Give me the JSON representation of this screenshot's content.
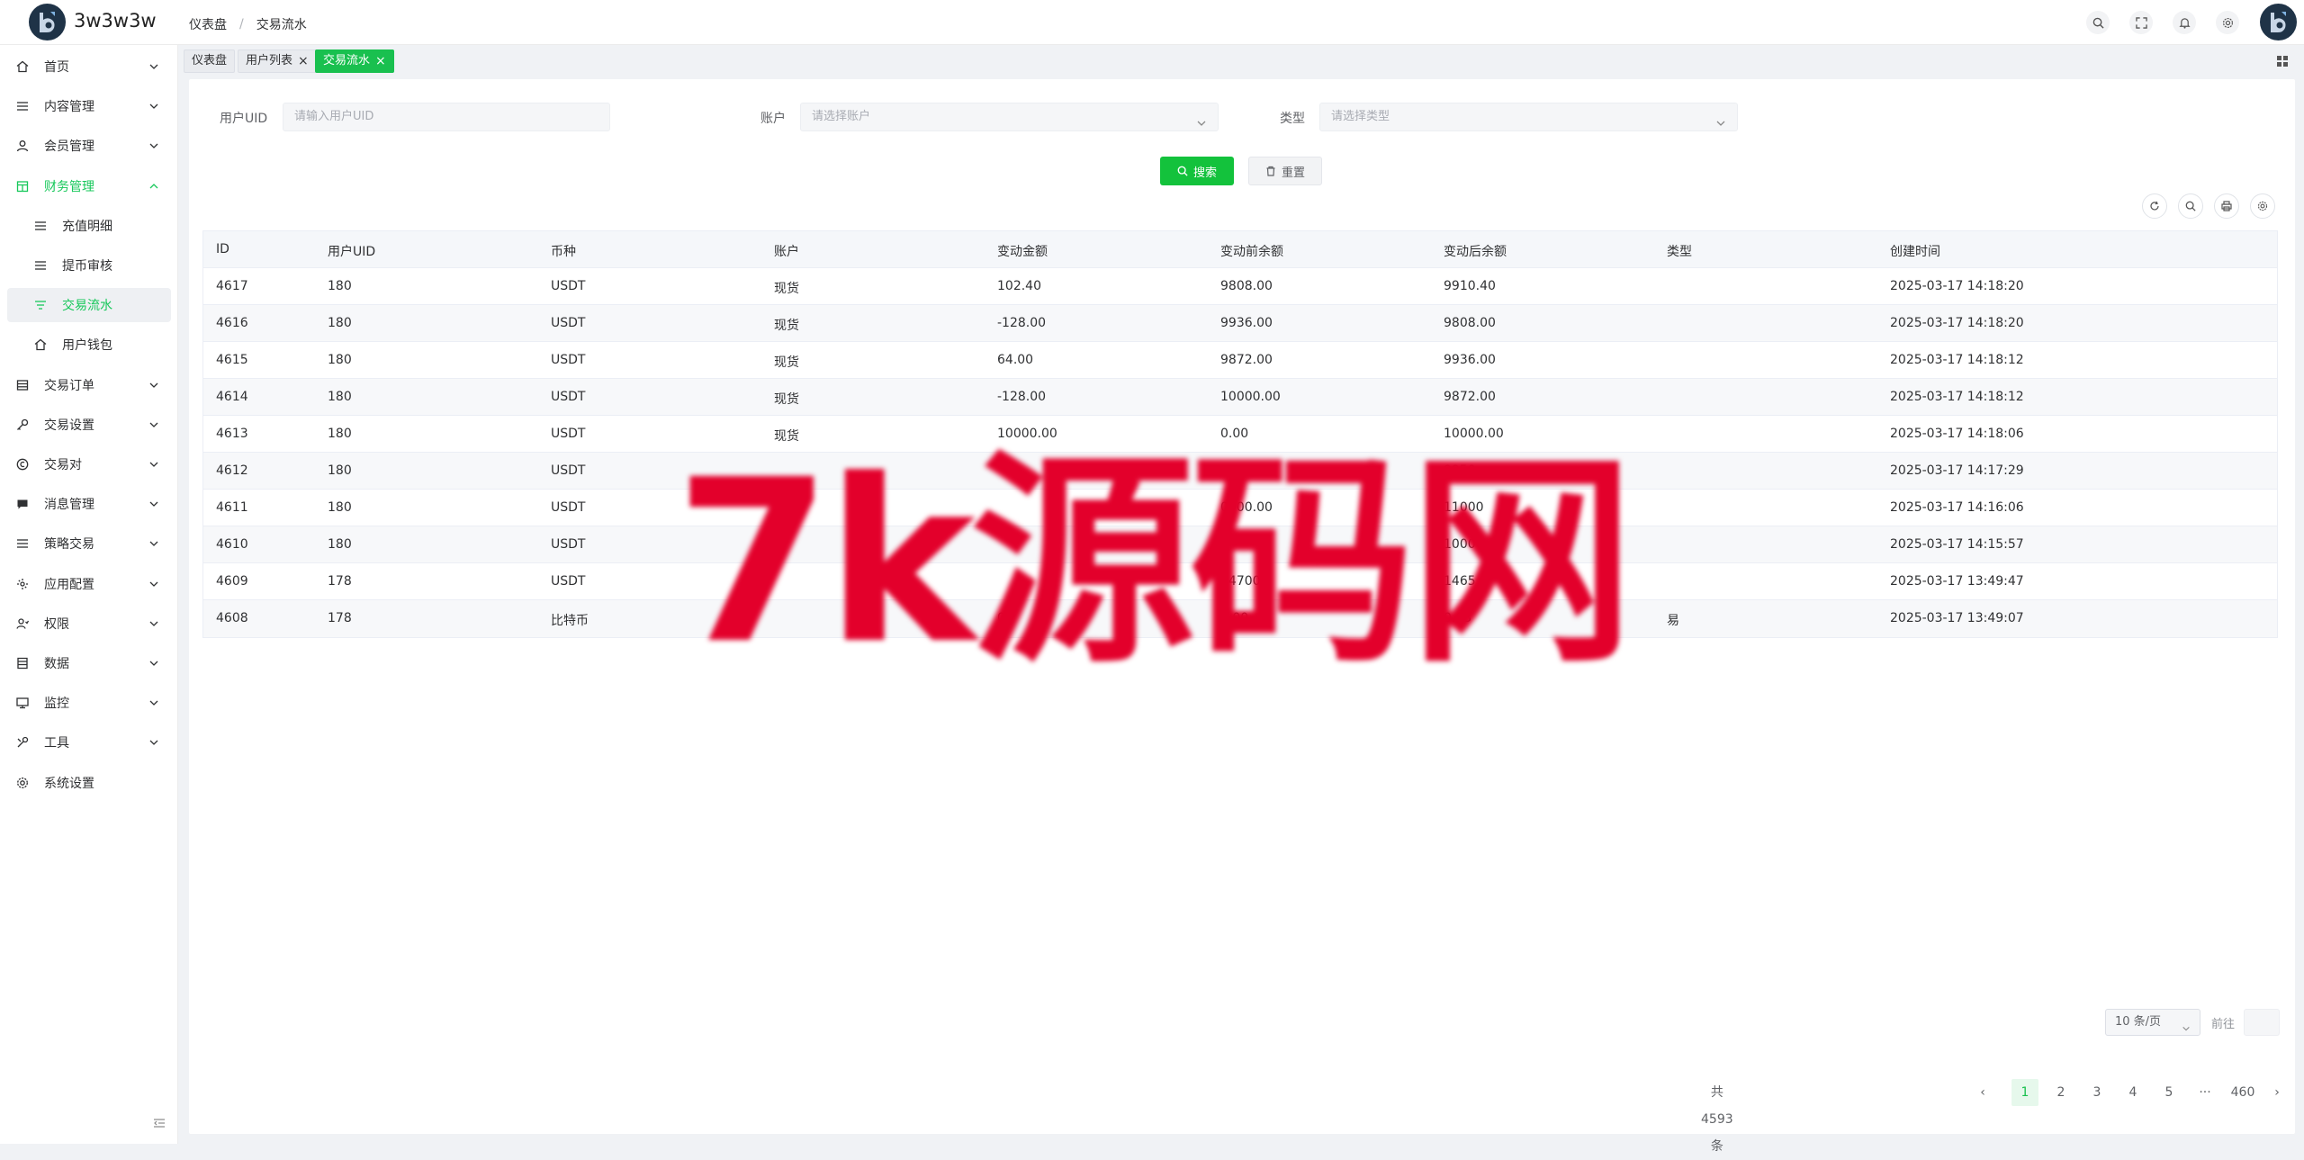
{
  "app": {
    "title": "3w3w3w"
  },
  "header": {
    "breadcrumb": [
      "仪表盘",
      "/",
      "交易流水"
    ],
    "icons": [
      "search-icon",
      "fullscreen-icon",
      "bell-icon",
      "gear-icon"
    ]
  },
  "sidebar": {
    "items": [
      {
        "label": "首页",
        "icon": "home-icon",
        "expandable": true
      },
      {
        "label": "内容管理",
        "icon": "list-icon",
        "expandable": true
      },
      {
        "label": "会员管理",
        "icon": "user-icon",
        "expandable": true
      },
      {
        "label": "财务管理",
        "icon": "finance-icon",
        "expandable": true,
        "open": true
      },
      {
        "label": "充值明细",
        "icon": "list-icon",
        "sub": true
      },
      {
        "label": "提币审核",
        "icon": "list-icon",
        "sub": true
      },
      {
        "label": "交易流水",
        "icon": "filter-icon",
        "sub": true,
        "active": true
      },
      {
        "label": "用户钱包",
        "icon": "home-icon",
        "sub": true
      },
      {
        "label": "交易订单",
        "icon": "table-icon",
        "expandable": true
      },
      {
        "label": "交易设置",
        "icon": "key-icon",
        "expandable": true
      },
      {
        "label": "交易对",
        "icon": "copyright-icon",
        "expandable": true
      },
      {
        "label": "消息管理",
        "icon": "message-icon",
        "expandable": true
      },
      {
        "label": "策略交易",
        "icon": "list-icon",
        "expandable": true
      },
      {
        "label": "应用配置",
        "icon": "config-icon",
        "expandable": true
      },
      {
        "label": "权限",
        "icon": "permission-icon",
        "expandable": true
      },
      {
        "label": "数据",
        "icon": "data-icon",
        "expandable": true
      },
      {
        "label": "监控",
        "icon": "monitor-icon",
        "expandable": true
      },
      {
        "label": "工具",
        "icon": "tool-icon",
        "expandable": true
      },
      {
        "label": "系统设置",
        "icon": "gear-icon",
        "expandable": false
      }
    ]
  },
  "tags": [
    {
      "label": "仪表盘",
      "closable": false,
      "active": false
    },
    {
      "label": "用户列表",
      "closable": true,
      "active": false
    },
    {
      "label": "交易流水",
      "closable": true,
      "active": true
    }
  ],
  "filters": {
    "uid": {
      "label": "用户UID",
      "placeholder": "请输入用户UID"
    },
    "account": {
      "label": "账户",
      "placeholder": "请选择账户"
    },
    "type": {
      "label": "类型",
      "placeholder": "请选择类型"
    },
    "search_label": "搜索",
    "reset_label": "重置"
  },
  "table": {
    "columns": [
      "ID",
      "用户UID",
      "币种",
      "账户",
      "变动金额",
      "变动前余额",
      "变动后余额",
      "类型",
      "创建时间"
    ],
    "rows": [
      [
        "4617",
        "180",
        "USDT",
        "现货",
        "102.40",
        "9808.00",
        "9910.40",
        "",
        "2025-03-17 14:18:20"
      ],
      [
        "4616",
        "180",
        "USDT",
        "现货",
        "-128.00",
        "9936.00",
        "9808.00",
        "",
        "2025-03-17 14:18:20"
      ],
      [
        "4615",
        "180",
        "USDT",
        "现货",
        "64.00",
        "9872.00",
        "9936.00",
        "",
        "2025-03-17 14:18:12"
      ],
      [
        "4614",
        "180",
        "USDT",
        "现货",
        "-128.00",
        "10000.00",
        "9872.00",
        "",
        "2025-03-17 14:18:12"
      ],
      [
        "4613",
        "180",
        "USDT",
        "现货",
        "10000.00",
        "0.00",
        "10000.00",
        "",
        "2025-03-17 14:18:06"
      ],
      [
        "4612",
        "180",
        "USDT",
        "",
        "",
        "",
        "9950.",
        "",
        "2025-03-17 14:17:29"
      ],
      [
        "4611",
        "180",
        "USDT",
        "",
        "",
        "0000.00",
        "11000",
        "",
        "2025-03-17 14:16:06"
      ],
      [
        "4610",
        "180",
        "USDT",
        "",
        "",
        "",
        "10000",
        "",
        "2025-03-17 14:15:57"
      ],
      [
        "4609",
        "178",
        "USDT",
        "",
        "",
        "14700",
        "1465",
        "",
        "2025-03-17 13:49:47"
      ],
      [
        "4608",
        "178",
        "比特币",
        "",
        "03",
        "0.00",
        "0.03",
        "易",
        "2025-03-17 13:49:07"
      ]
    ]
  },
  "pagination": {
    "total_label": "共 4593 条",
    "pages": [
      "1",
      "2",
      "3",
      "4",
      "5",
      "···",
      "460"
    ],
    "current": "1",
    "prev": "‹",
    "next": "›",
    "page_size": "10 条/页",
    "goto_label": "前往"
  },
  "watermark": "7k源码网",
  "colors": {
    "accent": "#19c04f",
    "watermark": "#e3002b",
    "logo_bg": "#1f3347"
  }
}
